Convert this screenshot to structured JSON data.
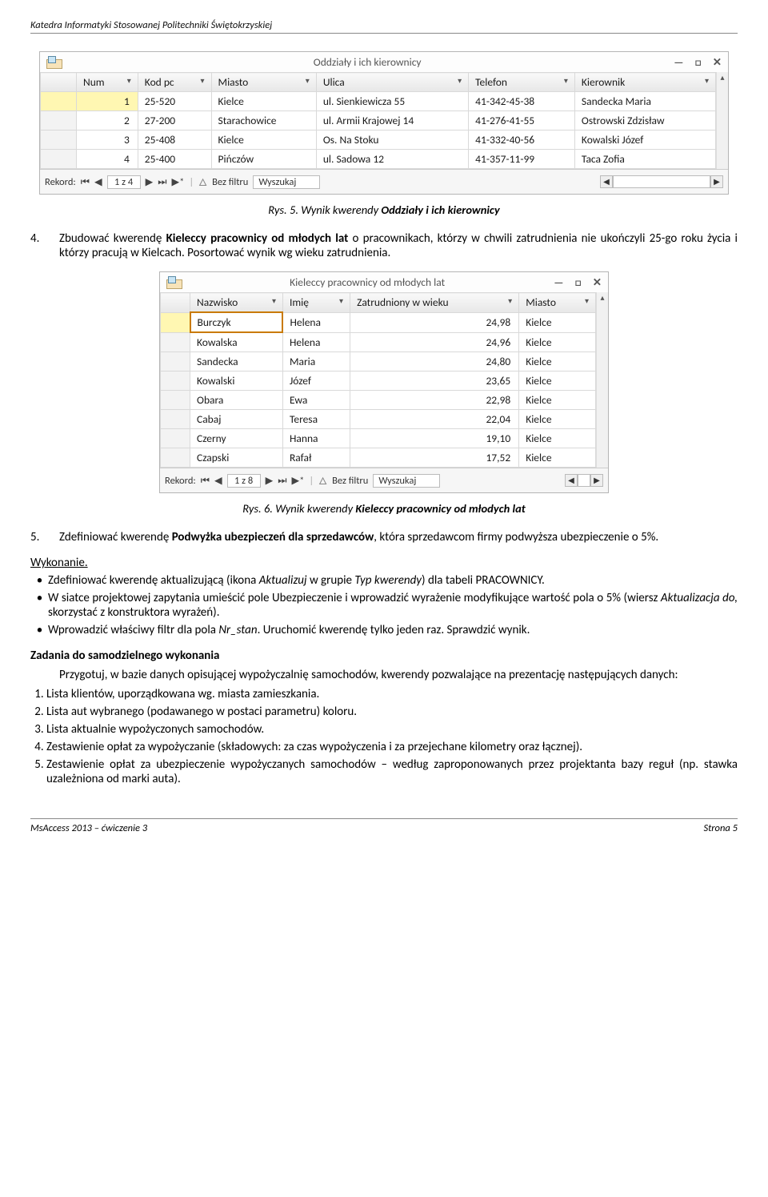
{
  "header": "Katedra Informatyki Stosowanej Politechniki Świętokrzyskiej",
  "table1": {
    "title": "Oddziały i ich kierownicy",
    "win_btn_min": "—",
    "win_btn_max": "□",
    "win_btn_close": "✕",
    "cols": [
      "Num",
      "Kod pc",
      "Miasto",
      "Ulica",
      "Telefon",
      "Kierownik"
    ],
    "rows": [
      [
        "1",
        "25-520",
        "Kielce",
        "ul. Sienkiewicza 55",
        "41-342-45-38",
        "Sandecka  Maria"
      ],
      [
        "2",
        "27-200",
        "Starachowice",
        "ul. Armii Krajowej 14",
        "41-276-41-55",
        "Ostrowski  Zdzisław"
      ],
      [
        "3",
        "25-408",
        "Kielce",
        "Os. Na Stoku",
        "41-332-40-56",
        "Kowalski  Józef"
      ],
      [
        "4",
        "25-400",
        "Pińczów",
        "ul. Sadowa 12",
        "41-357-11-99",
        "Taca  Zofia"
      ]
    ],
    "status_rekord": "Rekord:",
    "status_pos": "1 z 4",
    "status_nofilter": "Bez filtru",
    "status_search": "Wyszukaj"
  },
  "caption1_pre": "Rys. 5. Wynik kwerendy ",
  "caption1_b": "Oddziały i ich kierownicy",
  "item4": {
    "num": "4.",
    "text_pre": "Zbudować kwerendę ",
    "text_b": "Kieleccy pracownicy od młodych lat",
    "text_post": " o pracownikach, którzy w chwili zatrudnienia nie ukończyli 25-go roku życia i którzy pracują w Kielcach. Posortować wynik wg wieku zatrudnienia."
  },
  "table2": {
    "title": "Kieleccy pracownicy od młodych lat",
    "win_btn_min": "—",
    "win_btn_max": "□",
    "win_btn_close": "✕",
    "cols": [
      "Nazwisko",
      "Imię",
      "Zatrudniony w wieku",
      "Miasto"
    ],
    "rows": [
      [
        "Burczyk",
        "Helena",
        "24,98",
        "Kielce"
      ],
      [
        "Kowalska",
        "Helena",
        "24,96",
        "Kielce"
      ],
      [
        "Sandecka",
        "Maria",
        "24,80",
        "Kielce"
      ],
      [
        "Kowalski",
        "Józef",
        "23,65",
        "Kielce"
      ],
      [
        "Obara",
        "Ewa",
        "22,98",
        "Kielce"
      ],
      [
        "Cabaj",
        "Teresa",
        "22,04",
        "Kielce"
      ],
      [
        "Czerny",
        "Hanna",
        "19,10",
        "Kielce"
      ],
      [
        "Czapski",
        "Rafał",
        "17,52",
        "Kielce"
      ]
    ],
    "status_rekord": "Rekord:",
    "status_pos": "1 z 8",
    "status_nofilter": "Bez filtru",
    "status_search": "Wyszukaj"
  },
  "caption2_pre": "Rys. 6. Wynik kwerendy ",
  "caption2_b": "Kieleccy pracownicy od młodych lat",
  "item5": {
    "num": "5.",
    "text_pre": "Zdefiniować kwerendę ",
    "text_b": "Podwyżka ubezpieczeń dla sprzedawców",
    "text_post": ", która sprzedawcom firmy podwyższa ubezpieczenie o 5%."
  },
  "wykon_label": "Wykonanie.",
  "bullets": {
    "b1_pre": "Zdefiniować kwerendę aktualizującą (ikona ",
    "b1_i1": "Aktualizuj",
    "b1_mid": " w grupie ",
    "b1_i2": "Typ kwerendy",
    "b1_post": ") dla tabeli PRACOWNICY.",
    "b2_pre": "W siatce projektowej zapytania umieścić pole Ubezpieczenie i wprowadzić wyrażenie modyfikujące wartość pola o 5% (wiersz ",
    "b2_i1": "Aktualizacja do,",
    "b2_post": " skorzystać z konstruktora wyrażeń).",
    "b3_pre": "Wprowadzić właściwy filtr dla pola ",
    "b3_i1": "Nr_stan",
    "b3_post": ". Uruchomić kwerendę tylko jeden raz. Sprawdzić wynik."
  },
  "zad_h": "Zadania do samodzielnego wykonania",
  "zad_intro": "Przygotuj, w bazie danych opisującej wypożyczalnię samochodów, kwerendy pozwalające na prezentację następujących danych:",
  "zad_list": [
    "Lista klientów, uporządkowana wg. miasta zamieszkania.",
    "Lista aut wybranego (podawanego w postaci parametru) koloru.",
    "Lista aktualnie wypożyczonych samochodów.",
    "Zestawienie opłat za wypożyczanie (składowych: za czas wypożyczenia i za przejechane kilometry oraz łącznej).",
    "Zestawienie opłat za ubezpieczenie wypożyczanych samochodów – według zaproponowanych przez projektanta bazy reguł (np. stawka uzależniona od marki auta)."
  ],
  "footer_left": "MsAccess 2013 – ćwiczenie 3",
  "footer_right": "Strona  5"
}
